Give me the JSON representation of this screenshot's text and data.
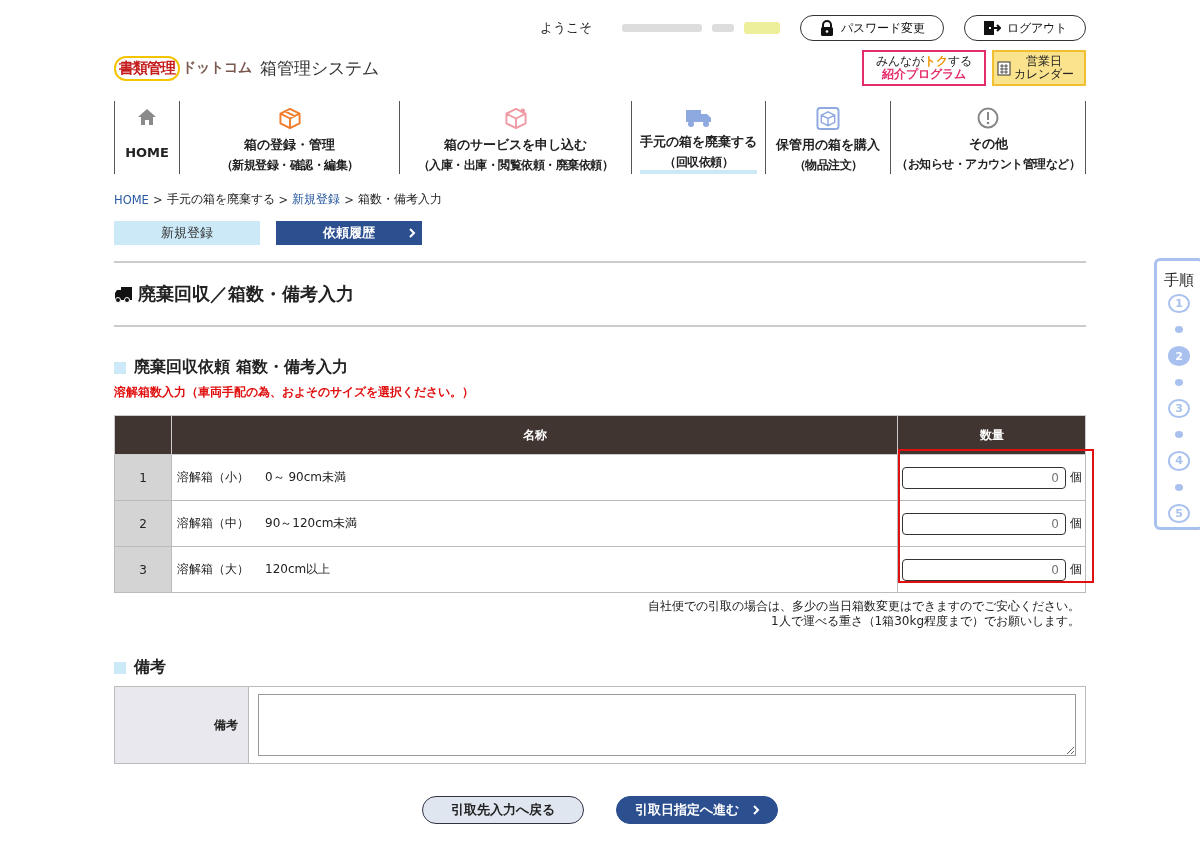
{
  "header": {
    "welcome": "ようこそ",
    "buttons": [
      {
        "label": "パスワード変更",
        "kind": "lock"
      },
      {
        "label": "ログアウト",
        "kind": "logout"
      }
    ],
    "logo": {
      "brand": "書類管理",
      "brand_sub": "ドットコム",
      "system": "箱管理システム"
    },
    "referral": {
      "prefix": "みんなが",
      "accent": "トク",
      "suffix": "する",
      "title": "紹介プログラム"
    },
    "calendar": {
      "line1": "営業日",
      "line2": "カレンダー"
    }
  },
  "nav": [
    {
      "label": "HOME",
      "kind": "home",
      "selected": false
    },
    {
      "label": "箱の登録・管理",
      "sub": "（新規登録・確認・編集）",
      "kind": "box",
      "selected": false
    },
    {
      "label": "箱のサービスを申し込む",
      "sub": "（入庫・出庫・閲覧依頼・廃棄依頼）",
      "kind": "service",
      "selected": false
    },
    {
      "label": "手元の箱を廃棄する",
      "sub": "（回収依頼）",
      "kind": "truck",
      "selected": true
    },
    {
      "label": "保管用の箱を購入",
      "sub": "（物品注文）",
      "kind": "purchase",
      "selected": false
    },
    {
      "label": "その他",
      "sub": "（お知らせ・アカウント管理など）",
      "kind": "info",
      "selected": false
    }
  ],
  "breadcrumb": [
    {
      "label": "HOME",
      "link": true
    },
    {
      "label": ">",
      "kind": "separator"
    },
    {
      "label": "手元の箱を廃棄する",
      "link": false
    },
    {
      "label": ">",
      "kind": "separator"
    },
    {
      "label": "新規登録",
      "link": true
    },
    {
      "label": ">",
      "kind": "separator"
    },
    {
      "label": "箱数・備考入力",
      "link": false
    }
  ],
  "subnav": [
    {
      "label": "新規登録",
      "kind": "light"
    },
    {
      "label": "依頼履歴",
      "kind": "dark"
    }
  ],
  "page_title": "廃棄回収／箱数・備考入力",
  "section": {
    "heading": "廃棄回収依頼 箱数・備考入力",
    "note": "溶解箱数入力（車両手配の為、およそのサイズを選択ください。）"
  },
  "table": {
    "columns": [
      "名称",
      "数量"
    ],
    "highlight_quantity": true,
    "rows": [
      {
        "no": "1",
        "name": "溶解箱（小）",
        "size": "0～ 90cm未満",
        "placeholder": "0",
        "unit": "個"
      },
      {
        "no": "2",
        "name": "溶解箱（中）",
        "size": "90～120cm未満",
        "placeholder": "0",
        "unit": "個"
      },
      {
        "no": "3",
        "name": "溶解箱（大）",
        "size": "120cm以上",
        "placeholder": "0",
        "unit": "個"
      }
    ]
  },
  "notes": [
    "自社便での引取の場合は、多少の当日箱数変更はできますのでご安心ください。",
    "1人で運べる重さ（1箱30kg程度まで）でお願いします。"
  ],
  "remarks": {
    "heading": "備考",
    "label": "備考"
  },
  "steps": {
    "title": "手順",
    "items": [
      {
        "label": "1",
        "selected": false
      },
      {
        "label": "2",
        "selected": true
      },
      {
        "label": "3",
        "selected": false
      },
      {
        "label": "4",
        "selected": false
      },
      {
        "label": "5",
        "selected": false
      }
    ]
  },
  "buttons": [
    {
      "label": "引取先入力へ戻る",
      "kind": "back"
    },
    {
      "label": "引取日指定へ進む",
      "kind": "next"
    }
  ]
}
